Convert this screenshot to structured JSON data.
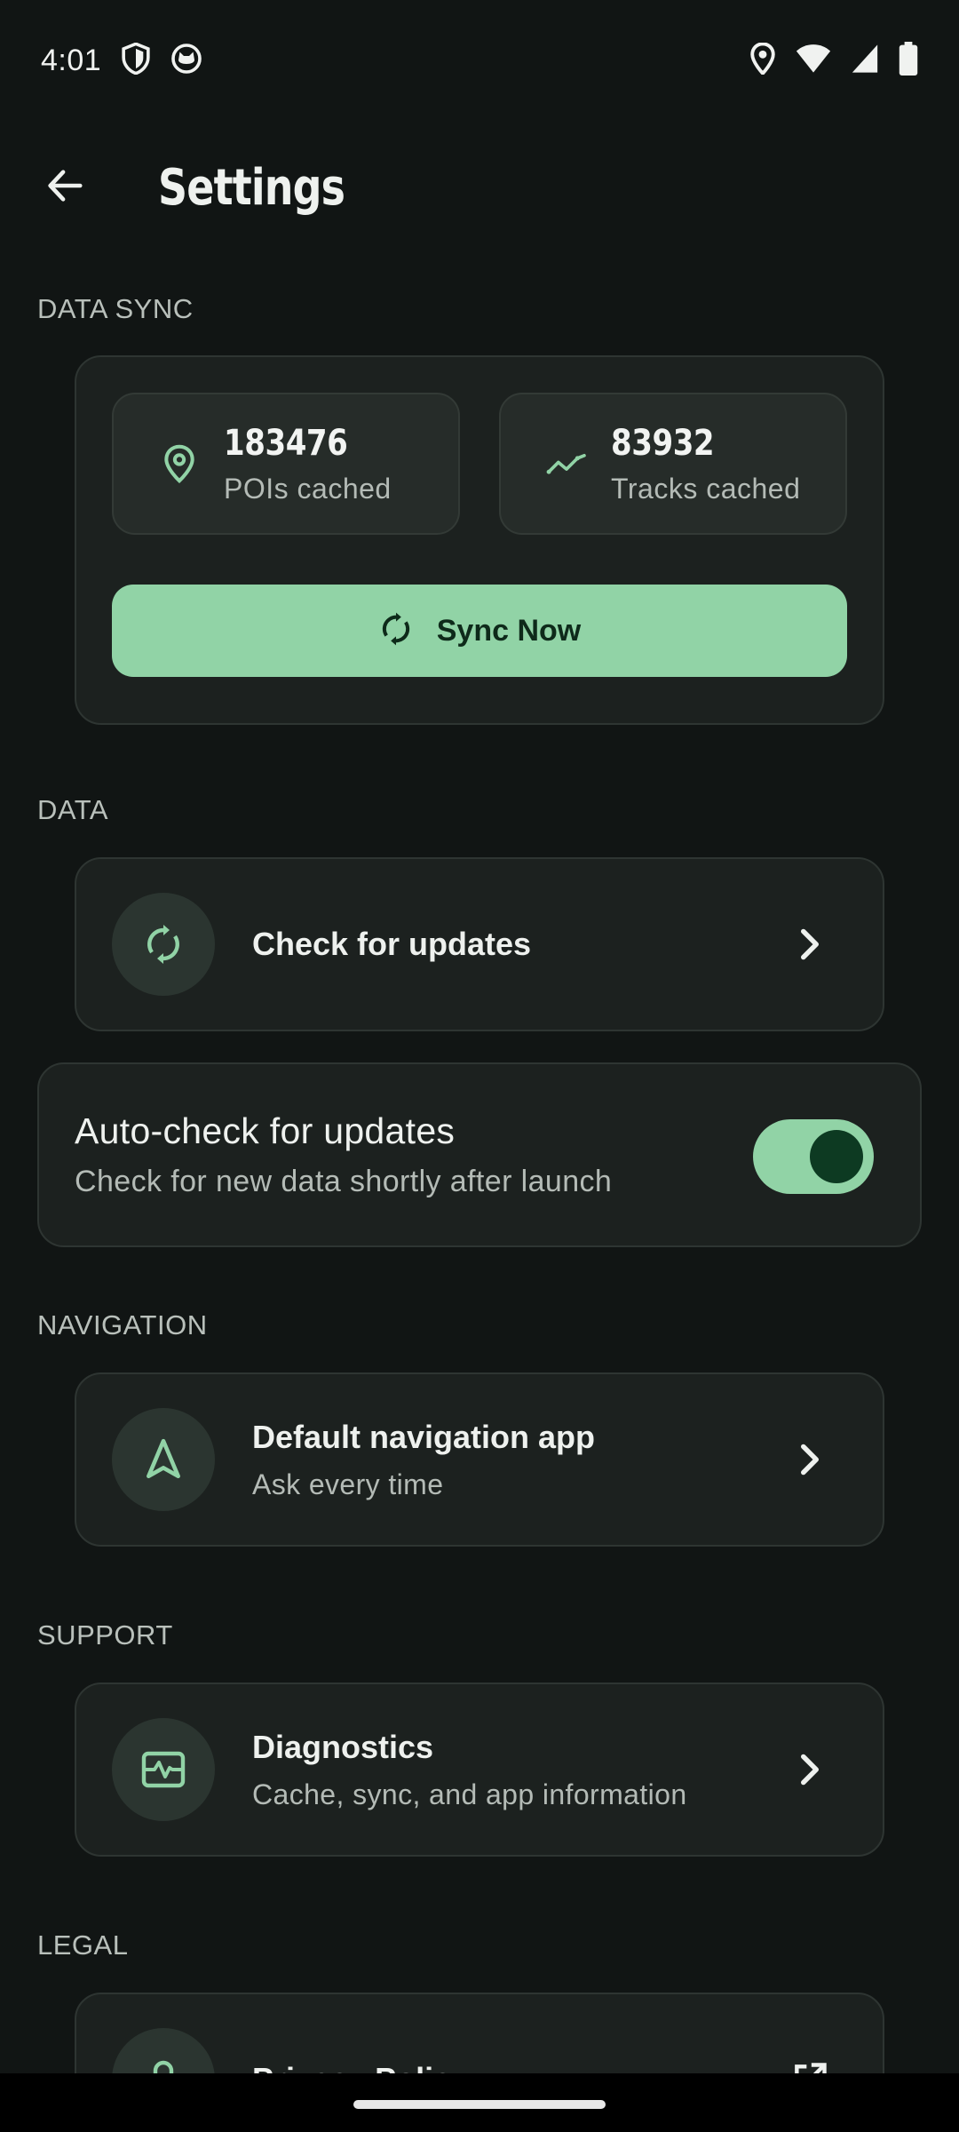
{
  "status_bar": {
    "time": "4:01",
    "left_icons": [
      "shield-icon",
      "cat-notification-icon"
    ],
    "right_icons": [
      "location-icon",
      "wifi-icon",
      "signal-icon",
      "battery-icon"
    ]
  },
  "app_bar": {
    "title": "Settings",
    "back_icon": "arrow-back-icon"
  },
  "sections": {
    "data_sync": "DATA SYNC",
    "data": "DATA",
    "navigation": "NAVIGATION",
    "support": "SUPPORT",
    "legal": "LEGAL"
  },
  "data_sync": {
    "pois": {
      "value": "183476",
      "caption": "POIs cached",
      "icon": "location-pin-icon"
    },
    "tracks": {
      "value": "83932",
      "caption": "Tracks cached",
      "icon": "trending-line-icon"
    },
    "sync_button": {
      "label": "Sync Now",
      "icon": "sync-icon"
    }
  },
  "data": {
    "check_updates": {
      "title": "Check for updates",
      "icon": "sync-icon"
    },
    "auto_check": {
      "title": "Auto-check for updates",
      "subtitle": "Check for new data shortly after launch",
      "enabled": true
    }
  },
  "navigation": {
    "default_app": {
      "title": "Default navigation app",
      "subtitle": "Ask every time",
      "icon": "navigation-arrow-icon"
    }
  },
  "support": {
    "diagnostics": {
      "title": "Diagnostics",
      "subtitle": "Cache, sync, and app information",
      "icon": "monitor-heart-icon"
    }
  },
  "legal": {
    "privacy": {
      "title": "Privacy Policy",
      "icon": "lock-icon",
      "trailing_icon": "open-external-icon"
    }
  },
  "colors": {
    "background": "#111514",
    "card": "#1c211f",
    "accent": "#91d3a6",
    "accent_dark": "#0e2a1a",
    "text_primary": "#eef1ee",
    "text_secondary": "#b4bbb6"
  }
}
